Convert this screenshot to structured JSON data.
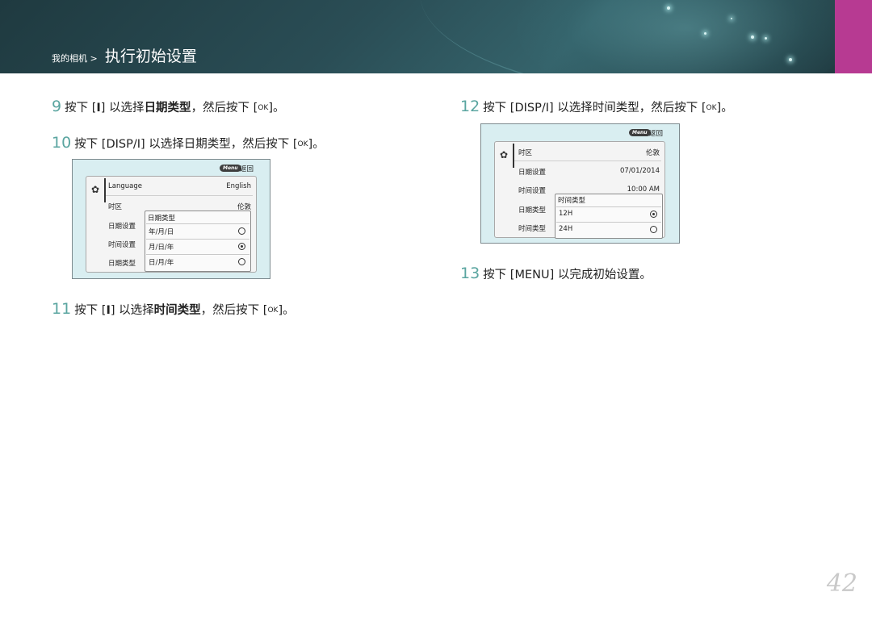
{
  "header": {
    "crumb_small": "我的相机 >",
    "crumb_big": "执行初始设置",
    "accent_tab_color": "#b73a92"
  },
  "steps": {
    "s9": {
      "num": "9",
      "pre": "按下 [",
      "key": "I",
      "mid": "] 以选择",
      "bold": "日期类型",
      "post": "，然后按下 [",
      "ok": "OK",
      "end": "]。"
    },
    "s10": {
      "num": "10",
      "text": "按下 [DISP/I] 以选择日期类型，然后按下 [",
      "ok": "OK",
      "end": "]。"
    },
    "s11": {
      "num": "11",
      "pre": "按下 [",
      "key": "I",
      "mid": "] 以选择",
      "bold": "时间类型",
      "post": "，然后按下 [",
      "ok": "OK",
      "end": "]。"
    },
    "s12": {
      "num": "12",
      "text": "按下 [DISP/I] 以选择时间类型，然后按下 [",
      "ok": "OK",
      "end": "]。"
    },
    "s13": {
      "num": "13",
      "text": "按下 [MENU] 以完成初始设置。"
    }
  },
  "screen_date": {
    "menu_label": "Menu",
    "back_label": "返回",
    "rows": [
      {
        "label": "Language",
        "value": "English"
      },
      {
        "label": "时区",
        "value": "伦敦"
      },
      {
        "label": "日期设置",
        "value": ""
      },
      {
        "label": "时间设置",
        "value": ""
      },
      {
        "label": "日期类型",
        "value": ""
      }
    ],
    "popup_title": "日期类型",
    "options": [
      {
        "label": "年/月/日",
        "selected": false
      },
      {
        "label": "月/日/年",
        "selected": true
      },
      {
        "label": "日/月/年",
        "selected": false
      }
    ]
  },
  "screen_time": {
    "menu_label": "Menu",
    "back_label": "返回",
    "rows": [
      {
        "label": "时区",
        "value": "伦敦"
      },
      {
        "label": "日期设置",
        "value": "07/01/2014"
      },
      {
        "label": "时间设置",
        "value": "10:00 AM"
      },
      {
        "label": "日期类型",
        "value": ""
      },
      {
        "label": "时间类型",
        "value": ""
      }
    ],
    "popup_title": "时间类型",
    "options": [
      {
        "label": "12H",
        "selected": true
      },
      {
        "label": "24H",
        "selected": false
      }
    ]
  },
  "page_number": "42"
}
